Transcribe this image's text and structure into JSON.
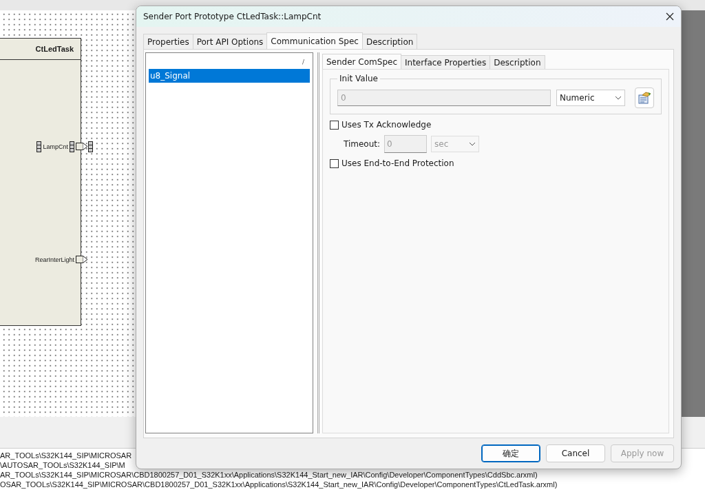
{
  "diagram": {
    "component": {
      "name": "CtLedTask",
      "ports": [
        {
          "label": "LampCnt",
          "kind": "sender_receiver"
        },
        {
          "label": "RearInterLight",
          "kind": "sender"
        }
      ]
    }
  },
  "dialog": {
    "title": "Sender Port Prototype CtLedTask::LampCnt",
    "tabs": [
      {
        "label": "Properties",
        "selected": false
      },
      {
        "label": "Port API Options",
        "selected": false
      },
      {
        "label": "Communication Spec",
        "selected": true
      },
      {
        "label": "Description",
        "selected": false
      }
    ],
    "element_list": {
      "header": "/",
      "items": [
        {
          "label": "u8_Signal",
          "selected": true
        }
      ]
    },
    "subtabs": [
      {
        "label": "Sender ComSpec",
        "selected": true
      },
      {
        "label": "Interface Properties",
        "selected": false
      },
      {
        "label": "Description",
        "selected": false
      }
    ],
    "init_value": {
      "legend": "Init Value",
      "value": "0",
      "disabled": true,
      "type": "Numeric"
    },
    "tx_acknowledge": {
      "label": "Uses Tx Acknowledge",
      "checked": false,
      "timeout_label": "Timeout:",
      "timeout_value": "0",
      "unit": "sec",
      "disabled": true
    },
    "end_to_end": {
      "label": "Uses End-to-End Protection",
      "checked": false
    },
    "buttons": [
      {
        "label": "确定",
        "kind": "default"
      },
      {
        "label": "Cancel",
        "kind": "normal"
      },
      {
        "label": "Apply now",
        "kind": "disabled"
      }
    ]
  },
  "log": {
    "lines": [
      "AR_TOOLs\\S32K144_SIP\\MICROSAR",
      "\\AUTOSAR_TOOLs\\S32K144_SIP\\M",
      "AR_TOOLs\\S32K144_SIP\\MICROSAR\\CBD1800257_D01_S32K1xx\\Applications\\S32K144_Start_new_IAR\\Config\\Developer\\ComponentTypes\\CddSbc.arxml)",
      "OSAR_TOOLs\\S32K144_SIP\\MICROSAR\\CBD1800257_D01_S32K1xx\\Applications\\S32K144_Start_new_IAR\\Config\\Developer\\ComponentTypes\\CtLedTask.arxml)"
    ]
  }
}
